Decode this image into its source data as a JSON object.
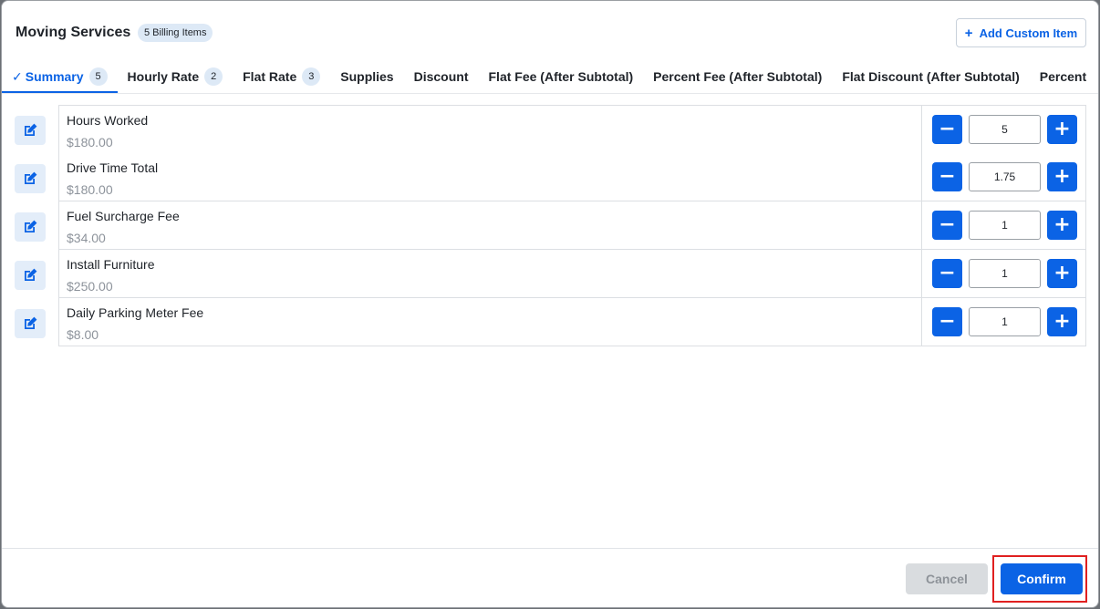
{
  "header": {
    "title": "Moving Services",
    "badge": "5 Billing Items",
    "add_custom_label": "Add Custom Item"
  },
  "tabs": [
    {
      "label": "Summary",
      "count": "5",
      "active": true
    },
    {
      "label": "Hourly Rate",
      "count": "2"
    },
    {
      "label": "Flat Rate",
      "count": "3"
    },
    {
      "label": "Supplies"
    },
    {
      "label": "Discount"
    },
    {
      "label": "Flat Fee (After Subtotal)"
    },
    {
      "label": "Percent Fee (After Subtotal)"
    },
    {
      "label": "Flat Discount (After Subtotal)"
    },
    {
      "label": "Percent"
    }
  ],
  "items": [
    {
      "name": "Hours Worked",
      "price": "$180.00",
      "quantity": "5"
    },
    {
      "name": "Drive Time Total",
      "price": "$180.00",
      "quantity": "1.75"
    },
    {
      "name": "Fuel Surcharge Fee",
      "price": "$34.00",
      "quantity": "1"
    },
    {
      "name": "Install Furniture",
      "price": "$250.00",
      "quantity": "1"
    },
    {
      "name": "Daily Parking Meter Fee",
      "price": "$8.00",
      "quantity": "1"
    }
  ],
  "footer": {
    "cancel_label": "Cancel",
    "confirm_label": "Confirm"
  },
  "colors": {
    "accent": "#0b63e5",
    "highlight_border": "#e02020"
  },
  "icons": {
    "edit": "edit-icon",
    "minus": "minus-icon",
    "plus": "plus-icon",
    "check": "check-icon"
  }
}
